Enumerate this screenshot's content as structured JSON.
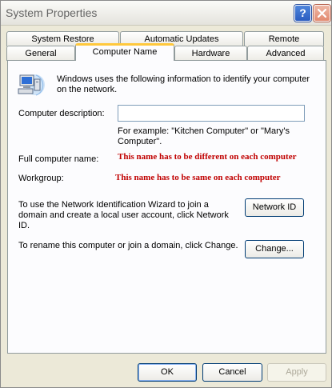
{
  "window": {
    "title": "System Properties"
  },
  "titlebar": {
    "help_label": "?",
    "close_label": "Close"
  },
  "tabs_row_top": [
    {
      "label": "System Restore"
    },
    {
      "label": "Automatic Updates"
    },
    {
      "label": "Remote"
    }
  ],
  "tabs_row_bottom": [
    {
      "label": "General"
    },
    {
      "label": "Computer Name"
    },
    {
      "label": "Hardware"
    },
    {
      "label": "Advanced"
    }
  ],
  "panel": {
    "intro_text": "Windows uses the following information to identify your computer on the network.",
    "description_label": "Computer description:",
    "description_value": "",
    "example_text": "For example: \"Kitchen Computer\" or \"Mary's Computer\".",
    "full_name_label": "Full computer name:",
    "full_name_note": "This name has to be different on each computer",
    "workgroup_label": "Workgroup:",
    "workgroup_note": "This name has to be same on each computer",
    "network_id_text": "To use the Network Identification Wizard to join a domain and create a local user account, click Network ID.",
    "network_id_button": "Network ID",
    "change_text": "To rename this computer or join a domain, click Change.",
    "change_button": "Change..."
  },
  "footer": {
    "ok_label": "OK",
    "cancel_label": "Cancel",
    "apply_label": "Apply"
  },
  "icons": {
    "computer": "computer-network-icon"
  },
  "colors": {
    "note_red": "#c00000",
    "active_tab_accent": "#ffc83c"
  }
}
